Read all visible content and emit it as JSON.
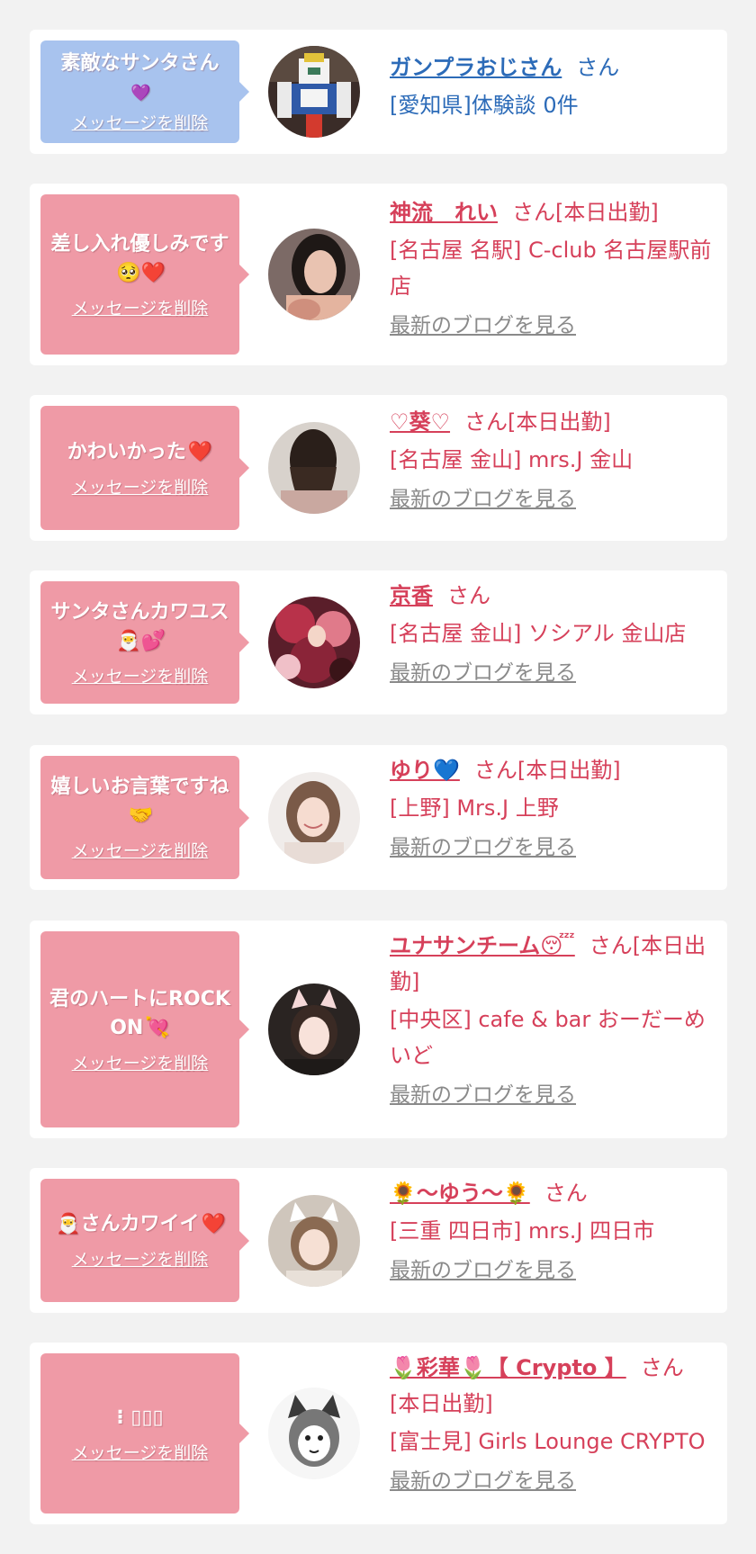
{
  "colors": {
    "bubble_blue": "#a8c3ee",
    "bubble_pink": "#ef9aa6",
    "name_pink": "#d6405a",
    "name_blue": "#2c6bb8",
    "blog_gray": "#8a8a8a"
  },
  "delete_label": "メッセージを削除",
  "blog_label": "最新のブログを見る",
  "items": [
    {
      "message": "素敵なサンタさん",
      "message_emoji": "💜",
      "name": "ガンプラおじさん",
      "suffix": "さん",
      "shop": "[愛知県]体験談 0件",
      "avatar_icon": "robot-figure-avatar"
    },
    {
      "message": "差し入れ優しみです",
      "message_emoji": "🥺❤️",
      "name": "神流　れい",
      "suffix": "さん[本日出勤]",
      "shop": "[名古屋 名駅] C-club 名古屋駅前店",
      "avatar_icon": "woman-portrait-avatar"
    },
    {
      "message": "かわいかった",
      "message_emoji": "❤️",
      "name": "♡葵♡",
      "suffix": "さん[本日出勤]",
      "shop": "[名古屋 金山] mrs.J 金山",
      "avatar_icon": "woman-back-avatar"
    },
    {
      "message": "サンタさんカワユス",
      "message_emoji": "🎅💕",
      "name": "京香",
      "suffix": "さん",
      "shop": "[名古屋 金山] ソシアル 金山店",
      "avatar_icon": "kimono-avatar"
    },
    {
      "message": "嬉しいお言葉ですね",
      "message_emoji": "🤝",
      "name": "ゆり💙",
      "suffix": "さん[本日出勤]",
      "shop": "[上野] Mrs.J 上野",
      "avatar_icon": "woman-smile-avatar"
    },
    {
      "message": "君のハートにROCK ON",
      "message_emoji": "💘",
      "name": "ユナサンチーム😴",
      "suffix": "さん[本日出勤]",
      "shop": "[中央区] cafe & bar おーだーめいど",
      "avatar_icon": "cat-ear-avatar"
    },
    {
      "message": "さんカワイイ",
      "message_emoji": "❤️",
      "message_lead_emoji": "🎅",
      "name": "🌻〜ゆう〜🌻",
      "suffix": "さん",
      "shop": "[三重 四日市] mrs.J 四日市",
      "avatar_icon": "cat-filter-avatar"
    },
    {
      "message": "⁝ ▯▯▯",
      "message_emoji": "",
      "name": "🌷彩華🌷【 Crypto 】",
      "suffix": "さん[本日出勤]",
      "shop": "[富士見] Girls Lounge CRYPTO",
      "avatar_icon": "cat-mask-avatar"
    }
  ]
}
